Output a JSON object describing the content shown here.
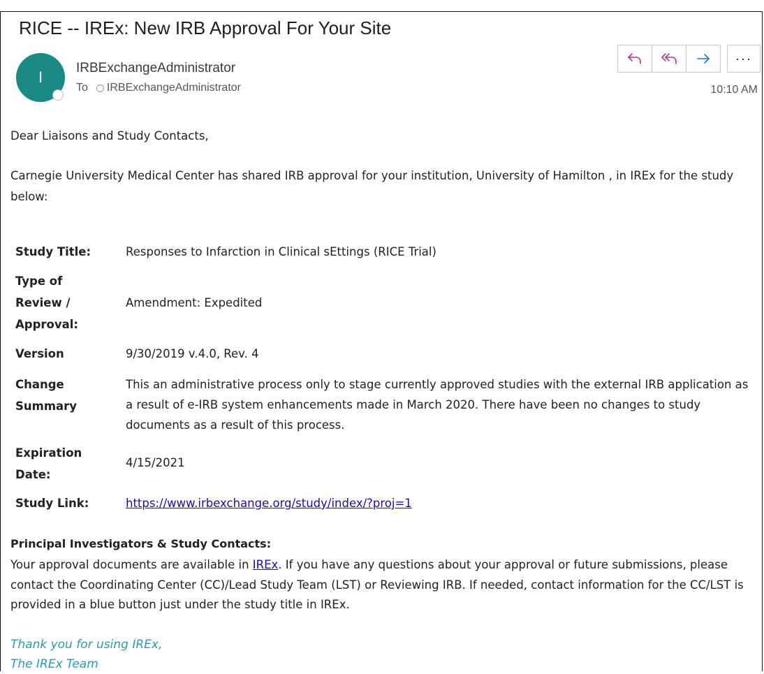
{
  "email": {
    "subject": "RICE -- IREx: New IRB Approval For Your Site",
    "avatar_initial": "I",
    "sender": "IRBExchangeAdministrator",
    "to_label": "To",
    "recipient": "IRBExchangeAdministrator",
    "time": "10:10 AM"
  },
  "toolbar": {
    "reply_icon": "reply-icon",
    "reply_all_icon": "reply-all-icon",
    "forward_icon": "forward-icon",
    "more_label": "···",
    "accent_color": "#b0368a",
    "forward_color": "#1b7ac0"
  },
  "body": {
    "greeting": "Dear Liaisons and Study Contacts,",
    "intro": "Carnegie University Medical Center has shared IRB approval for your institution, University of Hamilton , in IREx for the study below:",
    "details": [
      {
        "label": "Study Title:",
        "value": "Responses to Infarction in Clinical sEttings (RICE Trial)"
      },
      {
        "label": "Type of Review / Approval:",
        "value": "Amendment: Expedited"
      },
      {
        "label": "Version",
        "value": "9/30/2019 v.4.0, Rev. 4"
      },
      {
        "label": "Change Summary",
        "value": "This an administrative process only to stage currently approved studies with the external IRB application as a result of e-IRB system enhancements made in March 2020. There have been no changes to study documents as a result of this process."
      },
      {
        "label": "Expiration Date:",
        "value": "4/15/2021"
      },
      {
        "label": "Study Link:",
        "value": "https://www.irbexchange.org/study/index/?proj=1"
      }
    ],
    "pi_title": "Principal Investigators & Study Contacts:",
    "pi_text_before": "Your approval documents are available in ",
    "pi_link": "IREx",
    "pi_text_after": ". If you have any questions about your approval or future submissions, please contact the Coordinating Center (CC)/Lead Study Team (LST) or Reviewing IRB. If needed, contact information for the CC/LST is provided in a blue button just under the study title in IREx.",
    "thanks_line1": "Thank you for using IREx,",
    "thanks_line2": "The IREx Team"
  }
}
